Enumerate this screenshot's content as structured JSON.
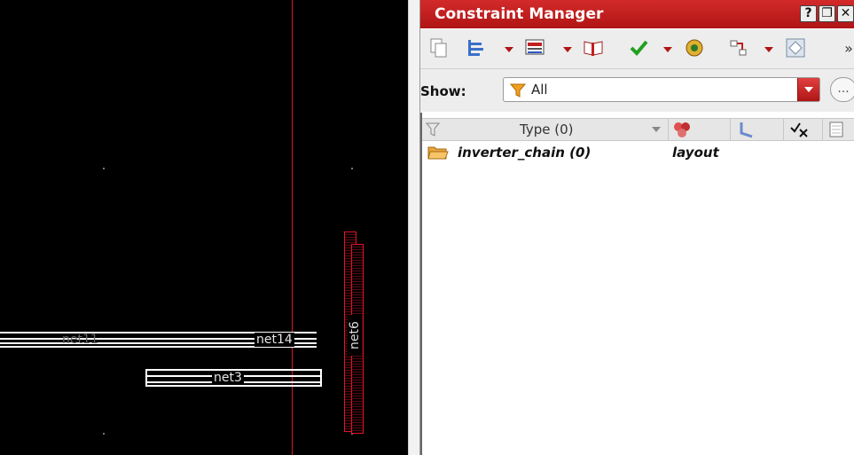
{
  "canvas": {
    "net_labels": {
      "net14": "net14",
      "net3": "net3",
      "net6": "net6",
      "ghost": "net11"
    }
  },
  "panel": {
    "title": "Constraint Manager",
    "window_buttons": {
      "help": "?",
      "restore": "❐",
      "close": "✕"
    },
    "toolbar": {
      "icons": [
        "copy-icon",
        "hierarchy-icon",
        "worksheet-icon",
        "book-icon",
        "check-icon",
        "analyze-icon",
        "connect-icon",
        "region-icon"
      ],
      "overflow": "»"
    },
    "show": {
      "label": "Show:",
      "selected": "All",
      "more": "..."
    },
    "grid": {
      "columns": {
        "type_header": "Type (0)"
      },
      "rows": [
        {
          "name": "inverter_chain (0)",
          "type": "layout"
        }
      ]
    }
  },
  "colors": {
    "title_bar": "#c21f1f",
    "canvas_bg": "#000000",
    "marker_line": "#e0142a"
  }
}
